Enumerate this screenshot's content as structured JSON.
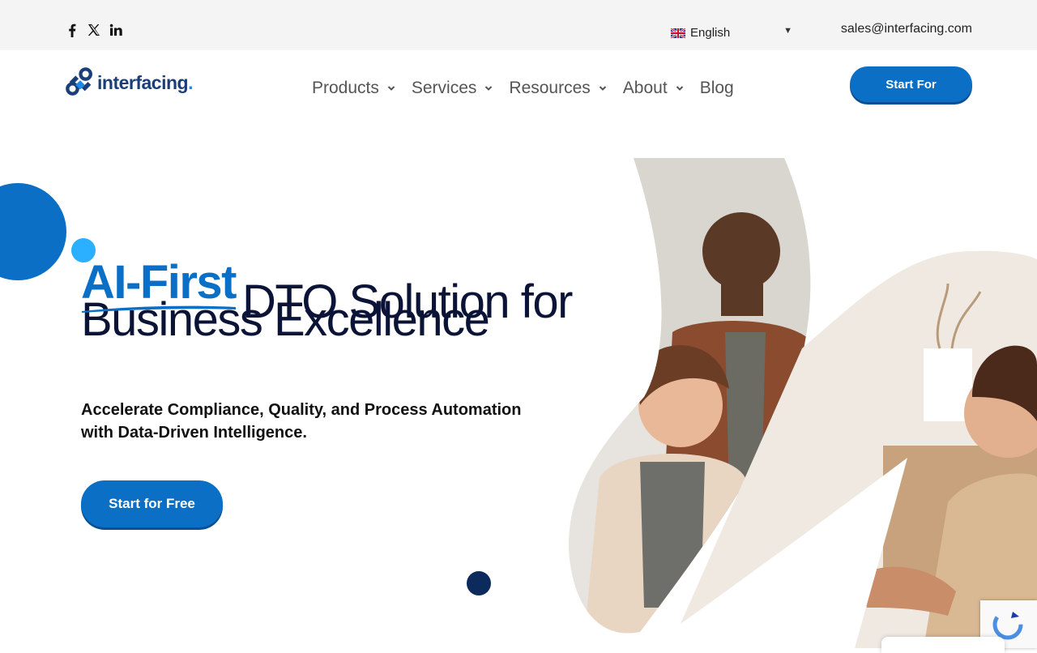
{
  "topbar": {
    "social": [
      {
        "icon": "facebook-icon"
      },
      {
        "icon": "x-twitter-icon"
      },
      {
        "icon": "linkedin-icon"
      }
    ],
    "language": {
      "label": "English",
      "flag_icon": "uk-flag-icon",
      "caret": "▼"
    },
    "email": "sales@interfacing.com"
  },
  "header": {
    "logo_text": "interfacing",
    "logo_dot": ".",
    "nav": [
      {
        "label": "Products",
        "has_dropdown": true
      },
      {
        "label": "Services",
        "has_dropdown": true
      },
      {
        "label": "Resources",
        "has_dropdown": true
      },
      {
        "label": "About",
        "has_dropdown": true
      },
      {
        "label": "Blog",
        "has_dropdown": false
      }
    ],
    "cta_label": "Start For"
  },
  "hero": {
    "headline_accent": "AI-First",
    "headline_rest": "DTO Solution for",
    "headline_line2": "Business Excellence",
    "subheadline": "Accelerate Compliance, Quality, and Process Automation with Data-Driven Intelligence.",
    "cta_label": "Start for Free"
  },
  "colors": {
    "brand_blue": "#0a6fc5",
    "navy": "#0b1437",
    "accent_cyan": "#2ab0ff"
  }
}
